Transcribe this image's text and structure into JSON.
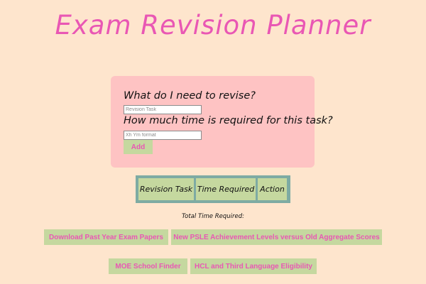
{
  "header": {
    "title": "Exam Revision Planner"
  },
  "form": {
    "task_question": "What do I need to revise?",
    "task_placeholder": "Revision Task",
    "task_value": "",
    "time_question": "How much time is required for this task?",
    "time_placeholder": "Xh Ym format",
    "time_value": "",
    "add_label": "Add"
  },
  "table": {
    "headers": [
      "Revision Task",
      "Time Required",
      "Action"
    ]
  },
  "summary": {
    "total_label": "Total Time Required:"
  },
  "links": [
    {
      "label": "Download Past Year Exam Papers"
    },
    {
      "label": "New PSLE Achievement Levels versus Old Aggregate Scores"
    },
    {
      "label": "MOE School Finder"
    },
    {
      "label": "HCL and Third Language Eligibility"
    }
  ],
  "colors": {
    "background": "#fee5cd",
    "accent_pink": "#e957b4",
    "card": "#fec3c3",
    "button_green": "#c5d89f",
    "table_border": "#7eaba3"
  }
}
